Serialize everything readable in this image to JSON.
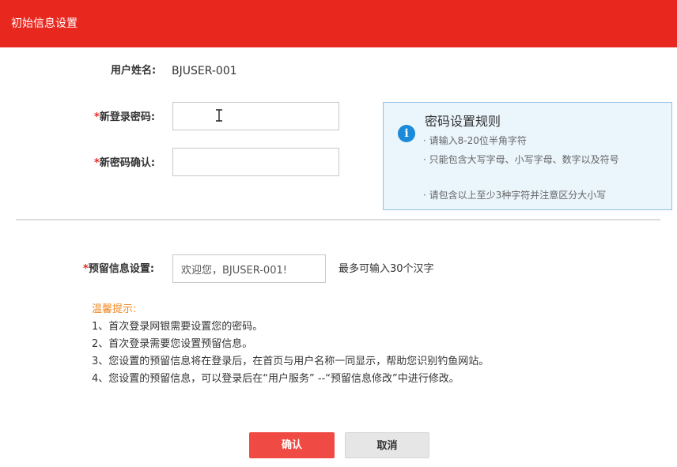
{
  "header": {
    "title": "初始信息设置"
  },
  "form": {
    "username_label": "用户姓名:",
    "username_value": "BJUSER-001",
    "required_mark": "*",
    "new_password_label": "新登录密码:",
    "new_password_value": "",
    "confirm_password_label": "新密码确认:",
    "confirm_password_value": "",
    "reserved_info_label": "预留信息设置:",
    "reserved_info_value": "欢迎您，BJUSER-001!",
    "reserved_info_hint": "最多可输入30个汉字"
  },
  "password_rules": {
    "icon_glyph": "i",
    "title": "密码设置规则",
    "items": [
      "· 请输入8-20位半角字符",
      "· 只能包含大写字母、小写字母、数字以及符号",
      "· 请包含以上至少3种字符并注意区分大小写"
    ]
  },
  "tips": {
    "title": "温馨提示:",
    "items": [
      "1、首次登录网银需要设置您的密码。",
      "2、首次登录需要您设置预留信息。",
      "3、您设置的预留信息将在登录后，在首页与用户名称一同显示，帮助您识别钓鱼网站。",
      "4、您设置的预留信息，可以登录后在“用户服务” --“预留信息修改”中进行修改。"
    ]
  },
  "buttons": {
    "confirm": "确认",
    "cancel": "取消"
  },
  "colors": {
    "header_bg": "#e8281f",
    "confirm_bg": "#f04a44",
    "cancel_bg": "#e6e6e6",
    "rules_bg": "#eaf5fc",
    "rules_border": "#8fc2e6",
    "info_icon": "#1b8ad8",
    "tips_title": "#f08a24",
    "required": "#e8281f"
  },
  "icons": {
    "info": "info-icon",
    "text_cursor": "text-cursor-icon"
  }
}
